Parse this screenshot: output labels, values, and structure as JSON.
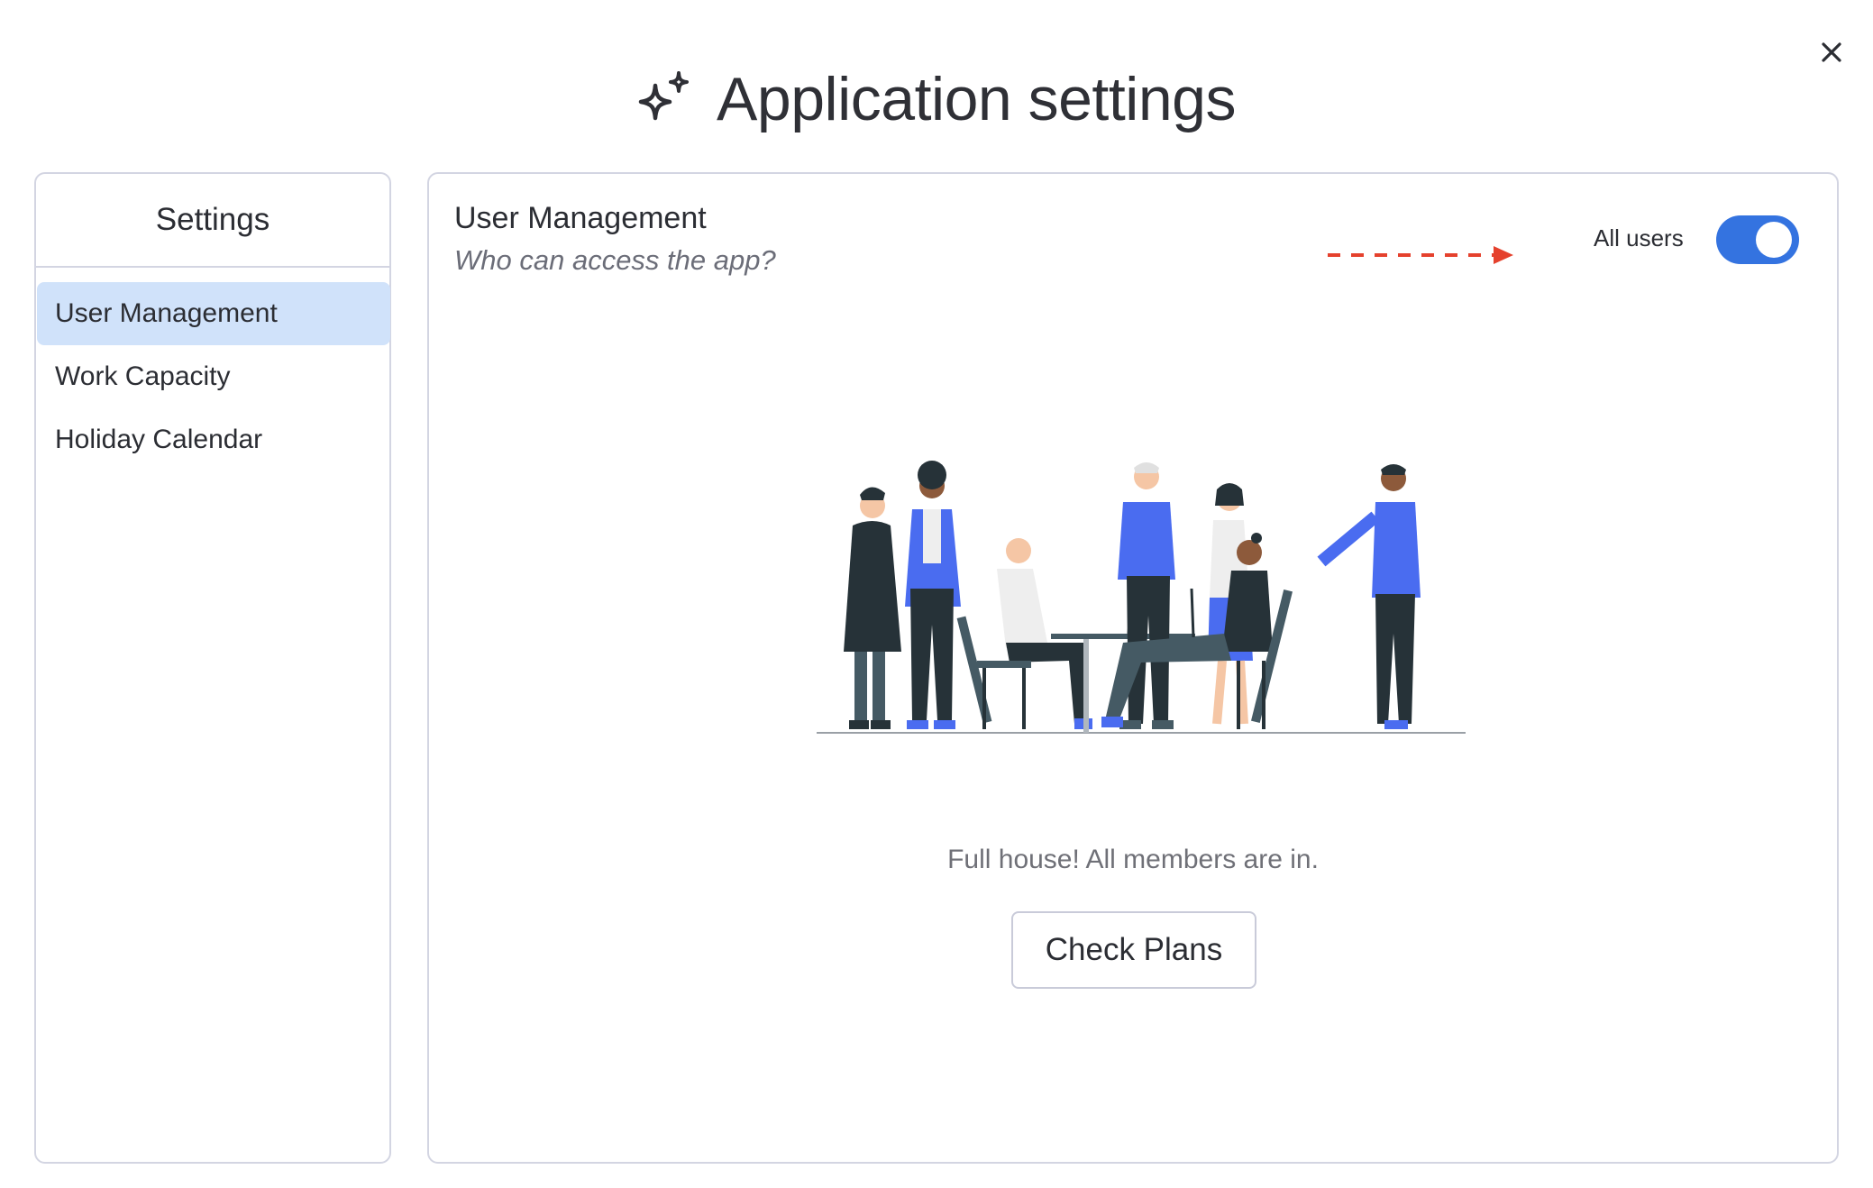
{
  "header": {
    "title": "Application settings",
    "icon": "sparkles-icon"
  },
  "close": {
    "icon": "close-icon"
  },
  "sidebar": {
    "title": "Settings",
    "items": [
      {
        "label": "User Management",
        "active": true
      },
      {
        "label": "Work Capacity",
        "active": false
      },
      {
        "label": "Holiday Calendar",
        "active": false
      }
    ]
  },
  "main": {
    "title": "User Management",
    "subtitle": "Who can access the app?",
    "toggle": {
      "label": "All users",
      "on": true
    },
    "empty_message": "Full house! All members are in.",
    "check_plans_label": "Check Plans"
  },
  "colors": {
    "accent": "#3473e0",
    "active_item_bg": "#d0e2fa",
    "annotation_arrow": "#e5412d",
    "border": "#d3d5e2",
    "illustration_blue": "#4a6cf0",
    "illustration_dark": "#263238"
  }
}
